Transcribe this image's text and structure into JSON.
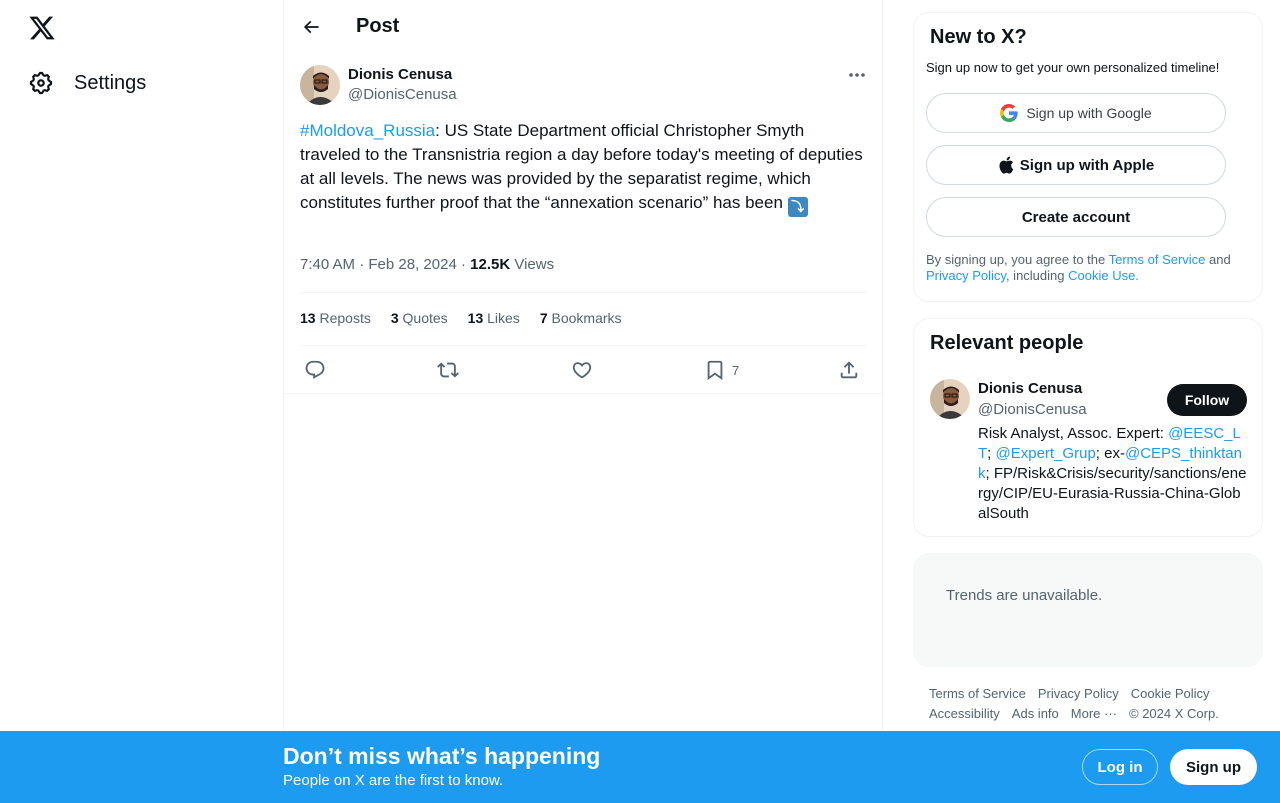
{
  "nav": {
    "logo_icon": "x-logo-icon",
    "settings_label": "Settings",
    "settings_icon": "gear-icon"
  },
  "header": {
    "title": "Post",
    "back_icon": "arrow-left-icon"
  },
  "post": {
    "author_name": "Dionis Cenusa",
    "author_handle": "@DionisCenusa",
    "hashtag": "#Moldova_Russia",
    "text": ": US State Department official Christopher Smyth traveled to the Transnistria region a day before today's meeting of deputies at all levels. The news was provided by the separatist regime, which constitutes further proof that the “annexation scenario” has been ",
    "emoji": "⤵",
    "time": "7:40 AM",
    "date": "Feb 28, 2024",
    "views_count": "12.5K",
    "views_label": "Views",
    "stats": {
      "reposts_count": "13",
      "reposts_label": "Reposts",
      "quotes_count": "3",
      "quotes_label": "Quotes",
      "likes_count": "13",
      "likes_label": "Likes",
      "bookmarks_count": "7",
      "bookmarks_label": "Bookmarks"
    },
    "actions": {
      "bookmark_count": "7"
    }
  },
  "signup_card": {
    "title": "New to X?",
    "subtitle": "Sign up now to get your own personalized timeline!",
    "google_label": "Sign up with Google",
    "apple_label": "Sign up with Apple",
    "create_label": "Create account",
    "legal_prefix": "By signing up, you agree to the ",
    "terms": "Terms of Service",
    "and": " and ",
    "privacy": "Privacy Policy",
    "including": ", including ",
    "cookie": "Cookie Use."
  },
  "relevant": {
    "title": "Relevant people",
    "name": "Dionis Cenusa",
    "handle": "@DionisCenusa",
    "follow_label": "Follow",
    "bio_1": "Risk Analyst, Assoc. Expert: ",
    "bio_link_1": "@EESC_LT",
    "bio_2": "; ",
    "bio_link_2": "@Expert_Grup",
    "bio_3": "; ex-",
    "bio_link_3": "@CEPS_thinktank",
    "bio_4": "; FP/Risk&Crisis/security/sanctions/energy/CIP/EU-Eurasia-Russia-China-GlobalSouth"
  },
  "trends": {
    "message": "Trends are unavailable."
  },
  "footer": {
    "terms": "Terms of Service",
    "privacy": "Privacy Policy",
    "cookie": "Cookie Policy",
    "accessibility": "Accessibility",
    "ads": "Ads info",
    "more": "More ···",
    "copyright": "© 2024 X Corp."
  },
  "banner": {
    "title": "Don’t miss what’s happening",
    "subtitle": "People on X are the first to know.",
    "login_label": "Log in",
    "signup_label": "Sign up",
    "background_color": "#1d9bf0"
  }
}
